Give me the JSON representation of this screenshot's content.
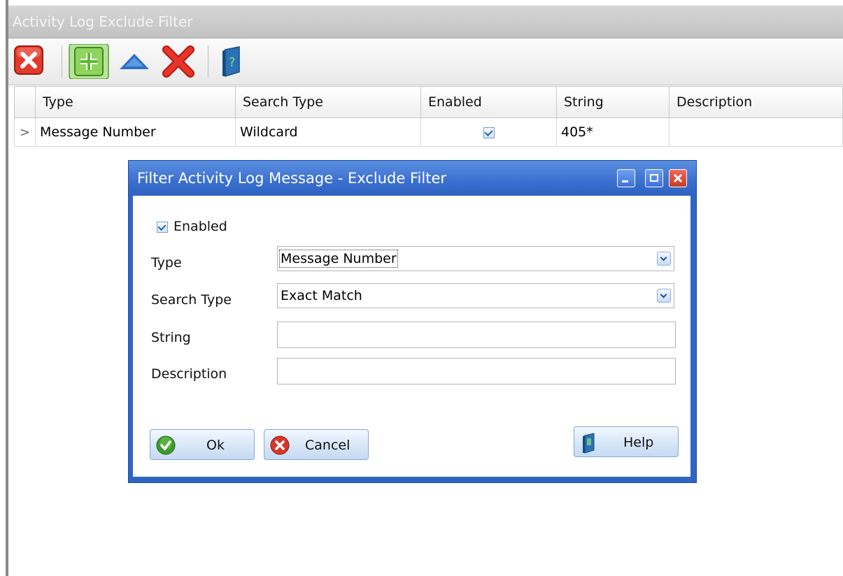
{
  "window": {
    "title": "Activity Log Exclude Filter"
  },
  "toolbar": {
    "buttons": [
      {
        "name": "close",
        "icon": "close-red-icon"
      },
      {
        "name": "add",
        "icon": "plus-green-icon"
      },
      {
        "name": "move-up",
        "icon": "triangle-up-icon"
      },
      {
        "name": "delete",
        "icon": "x-red-icon"
      },
      {
        "name": "help",
        "icon": "book-help-icon"
      }
    ]
  },
  "grid": {
    "columns": [
      "Type",
      "Search Type",
      "Enabled",
      "String",
      "Description"
    ],
    "rows": [
      {
        "indicator": ">",
        "type": "Message Number",
        "search_type": "Wildcard",
        "enabled": true,
        "string": "405*",
        "description": ""
      }
    ]
  },
  "dialog": {
    "title": "Filter Activity Log Message - Exclude Filter",
    "enabled_label": "Enabled",
    "enabled_checked": true,
    "type_label": "Type",
    "type_value": "Message Number",
    "search_type_label": "Search Type",
    "search_type_value": "Exact Match",
    "string_label": "String",
    "string_value": "",
    "description_label": "Description",
    "description_value": "",
    "ok_label": "Ok",
    "cancel_label": "Cancel",
    "help_label": "Help"
  },
  "colors": {
    "dialog_border": "#2f66c4",
    "titlebar_gray": "#c8c8c8",
    "button_blue": "#d7e6f8"
  }
}
